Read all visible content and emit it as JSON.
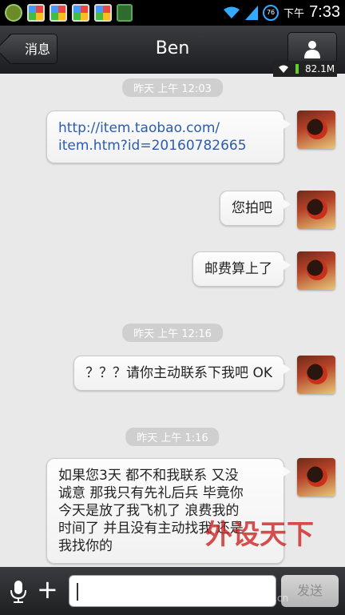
{
  "status_bar": {
    "time": "7:33",
    "ampm": "下午",
    "battery_level": "76",
    "app_icons": [
      "app-icon",
      "app-icon",
      "app-icon",
      "app-icon",
      "app-icon",
      "app-icon"
    ]
  },
  "title_bar": {
    "back_label": "消息",
    "title": "Ben",
    "profile_icon": "person-icon"
  },
  "net_overlay": {
    "speed": "82.1M"
  },
  "messages": [
    {
      "type": "timestamp",
      "text": "昨天 上午 12:03"
    },
    {
      "type": "bubble",
      "lines": [
        "http://item.taobao.com/",
        "item.htm?id=20160782665"
      ],
      "is_link": true
    },
    {
      "type": "bubble",
      "lines": [
        "您拍吧"
      ]
    },
    {
      "type": "bubble",
      "lines": [
        "邮费算上了"
      ]
    },
    {
      "type": "timestamp",
      "text": "昨天 上午 12:16"
    },
    {
      "type": "bubble",
      "lines": [
        "？？？请你主动联系下我吧 OK"
      ]
    },
    {
      "type": "timestamp",
      "text": "昨天 上午 1:16"
    },
    {
      "type": "bubble",
      "lines": [
        "如果您3天 都不和我联系 又没",
        "诚意 那我只有先礼后兵 毕竟你",
        "今天是放了我飞机了 浪费我的",
        "时间了 并且没有主动找我 还是",
        "我找你的"
      ]
    }
  ],
  "input_bar": {
    "placeholder": "",
    "send_label": "发送"
  },
  "watermark": {
    "logo": "外设天下",
    "url": "www.pcwaishe.cn"
  }
}
